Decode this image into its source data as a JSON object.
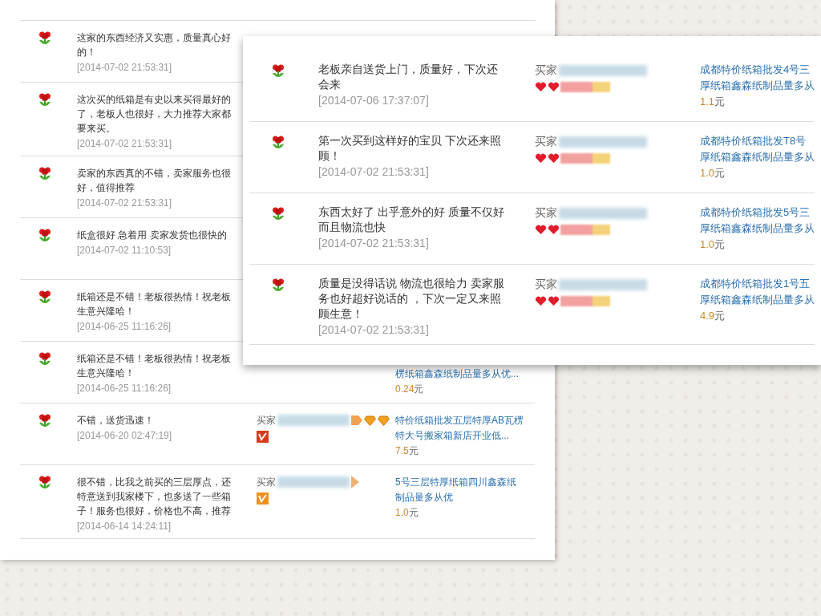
{
  "back_panel": {
    "reviews": [
      {
        "comment": "这家的东西经济又实惠，质量真心好的！",
        "time": "[2014-07-02 21:53:31]"
      },
      {
        "comment": "这次买的纸箱是有史以来买得最好的了，老板人也很好，大力推荐大家都要来买。",
        "time": "[2014-07-02 21:53:31]"
      },
      {
        "comment": "卖家的东西真的不错，卖家服务也很好，值得推荐",
        "time": "[2014-07-02 21:53:31]"
      },
      {
        "comment": "纸盒很好 急着用 卖家发货也很快的",
        "time": "[2014-07-02 11:10:53]"
      },
      {
        "comment": "纸箱还是不错！老板很热情！祝老板生意兴隆哈！",
        "time": "[2014-06-25 11:16:26]"
      },
      {
        "comment": "纸箱还是不错！老板很热情！祝老板生意兴隆哈！",
        "time": "[2014-06-25 11:16:26]",
        "product_lines": [
          "楞纸箱鑫森纸制品量多从优..."
        ],
        "price": "0.24",
        "currency": "元"
      },
      {
        "comment": "不错，送货迅速！",
        "time": "[2014-06-20 02:47:19]",
        "buyer_label": "买家",
        "kind": "diamonds",
        "product_lines": [
          "特价纸箱批发五层特厚AB瓦楞",
          "特大号搬家箱新店开业低..."
        ],
        "price": "7.5",
        "currency": "元"
      },
      {
        "comment": "很不错，比我之前买的三层厚点，还特意送到我家楼下，也多送了一些箱子！服务也很好，价格也不高，推荐",
        "time": "[2014-06-14 14:24:11]",
        "buyer_label": "买家",
        "kind": "plain",
        "product_lines": [
          "5号三层特厚纸箱四川鑫森纸",
          "制品量多从优"
        ],
        "price": "1.0",
        "currency": "元"
      }
    ]
  },
  "front_panel": {
    "reviews": [
      {
        "comment": "老板亲自送货上门，质量好，下次还会来",
        "time": "[2014-07-06 17:37:07]",
        "buyer_label": "买家",
        "kind": "hearts",
        "product_lines": [
          "成都特价纸箱批发4号三",
          "厚纸箱鑫森纸制品量多从"
        ],
        "price": "1.1",
        "currency": "元"
      },
      {
        "comment": "第一次买到这样好的宝贝 下次还来照顾！",
        "time": "[2014-07-02 21:53:31]",
        "buyer_label": "买家",
        "kind": "hearts",
        "product_lines": [
          "成都特价纸箱批发T8号",
          "厚纸箱鑫森纸制品量多从"
        ],
        "price": "1.0",
        "currency": "元"
      },
      {
        "comment": "东西太好了 出乎意外的好 质量不仅好而且物流也快",
        "time": "[2014-07-02 21:53:31]",
        "buyer_label": "买家",
        "kind": "hearts",
        "product_lines": [
          "成都特价纸箱批发5号三",
          "厚纸箱鑫森纸制品量多从"
        ],
        "price": "1.0",
        "currency": "元"
      },
      {
        "comment": "质量是没得话说 物流也很给力 卖家服务也好超好说话的 ，下次一定又来照顾生意！",
        "time": "[2014-07-02 21:53:31]",
        "buyer_label": "买家",
        "kind": "hearts",
        "product_lines": [
          "成都特价纸箱批发1号五",
          "厚纸箱鑫森纸制品量多从"
        ],
        "price": "4.9",
        "currency": "元"
      }
    ]
  }
}
